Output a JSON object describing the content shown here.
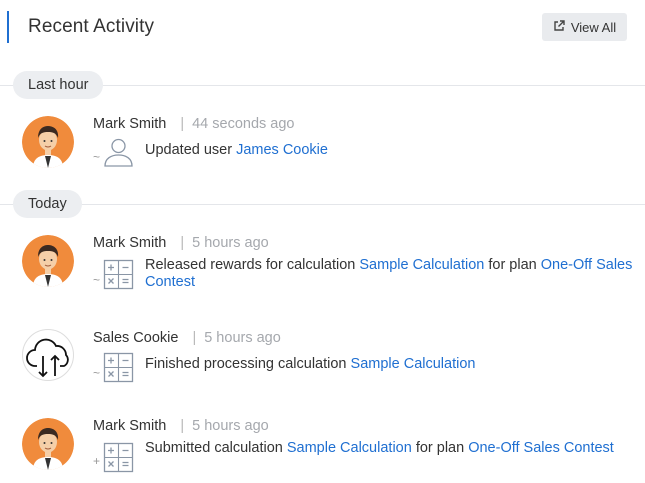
{
  "header": {
    "title": "Recent Activity",
    "view_all_label": "View All",
    "accent_color": "#1f6fd1"
  },
  "groups": [
    {
      "label": "Last hour"
    },
    {
      "label": "Today"
    }
  ],
  "entries": [
    {
      "actor": "Mark Smith",
      "time": "44 seconds ago",
      "avatar": "person-avatar",
      "icon": "user-icon",
      "prefix": "~",
      "t1": "Updated user ",
      "l1": "James Cookie"
    },
    {
      "actor": "Mark Smith",
      "time": "5 hours ago",
      "avatar": "person-avatar",
      "icon": "calculator-icon",
      "prefix": "~",
      "t1": "Released rewards for calculation ",
      "l1": "Sample Calculation",
      "t2": " for plan ",
      "l2": "One-Off Sales Contest"
    },
    {
      "actor": "Sales Cookie",
      "time": "5 hours ago",
      "avatar": "cloud-sync-icon",
      "icon": "calculator-icon",
      "prefix": "~",
      "t1": "Finished processing calculation ",
      "l1": "Sample Calculation"
    },
    {
      "actor": "Mark Smith",
      "time": "5 hours ago",
      "avatar": "person-avatar",
      "icon": "calculator-icon",
      "prefix": "+",
      "t1": "Submitted calculation ",
      "l1": "Sample Calculation",
      "t2": " for plan ",
      "l2": "One-Off Sales Contest"
    }
  ]
}
